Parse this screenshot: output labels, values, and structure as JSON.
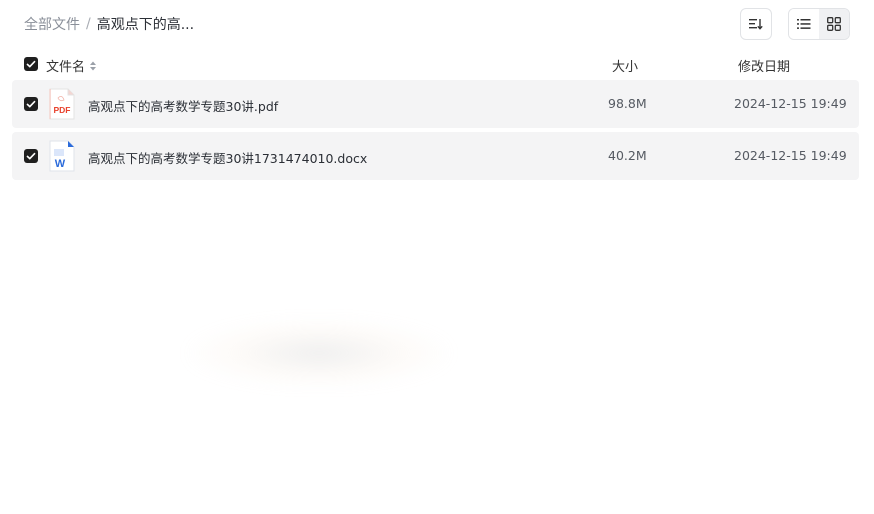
{
  "breadcrumb": {
    "root": "全部文件",
    "separator": "/",
    "current": "高观点下的高..."
  },
  "toolbar": {
    "sort_icon": "sort-icon",
    "list_view_icon": "list-view-icon",
    "grid_view_icon": "grid-view-icon",
    "active_view": "list"
  },
  "table": {
    "columns": {
      "name": "文件名",
      "size": "大小",
      "date": "修改日期"
    },
    "rows": [
      {
        "name": "高观点下的高考数学专题30讲.pdf",
        "size": "98.8M",
        "date": "2024-12-15 19:49",
        "type": "pdf",
        "icon_label": "PDF",
        "checked": true
      },
      {
        "name": "高观点下的高考数学专题30讲1731474010.docx",
        "size": "40.2M",
        "date": "2024-12-15 19:49",
        "type": "docx",
        "icon_label": "W",
        "checked": true
      }
    ]
  },
  "colors": {
    "pdf_red": "#e8412c",
    "word_blue": "#2b6bdb",
    "row_bg": "#f4f4f5",
    "checkbox": "#1f1f1f"
  }
}
